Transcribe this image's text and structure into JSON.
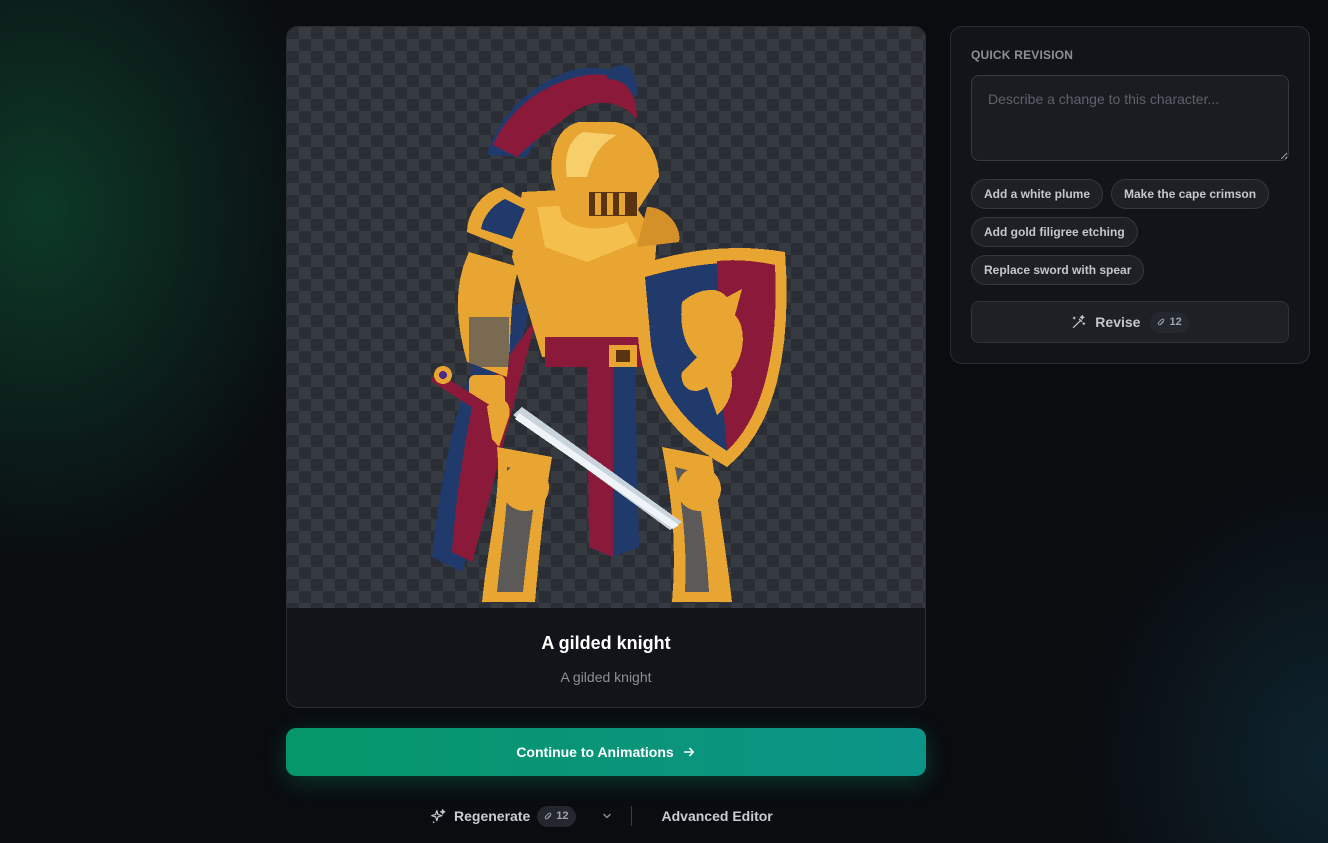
{
  "preview": {
    "character_title": "A gilded knight",
    "character_subtitle": "A gilded knight"
  },
  "actions": {
    "continue_label": "Continue to Animations",
    "regenerate_label": "Regenerate",
    "regenerate_cost": "12",
    "advanced_editor_label": "Advanced Editor"
  },
  "revision": {
    "heading": "QUICK REVISION",
    "placeholder": "Describe a change to this character...",
    "suggestions": [
      "Add a white plume",
      "Make the cape crimson",
      "Add gold filigree etching",
      "Replace sword with spear"
    ],
    "revise_label": "Revise",
    "revise_cost": "12"
  },
  "icons": {
    "continue": "arrow-right-icon",
    "regenerate": "sparkles-icon",
    "revise": "magic-wand-icon",
    "credit": "paperclip-icon",
    "dropdown": "chevron-down-icon"
  },
  "colors": {
    "accent_start": "#059669",
    "accent_end": "#0d9488",
    "gold": "#e8a531",
    "crimson": "#8b1a3a",
    "royal_blue": "#1f3a6b"
  }
}
